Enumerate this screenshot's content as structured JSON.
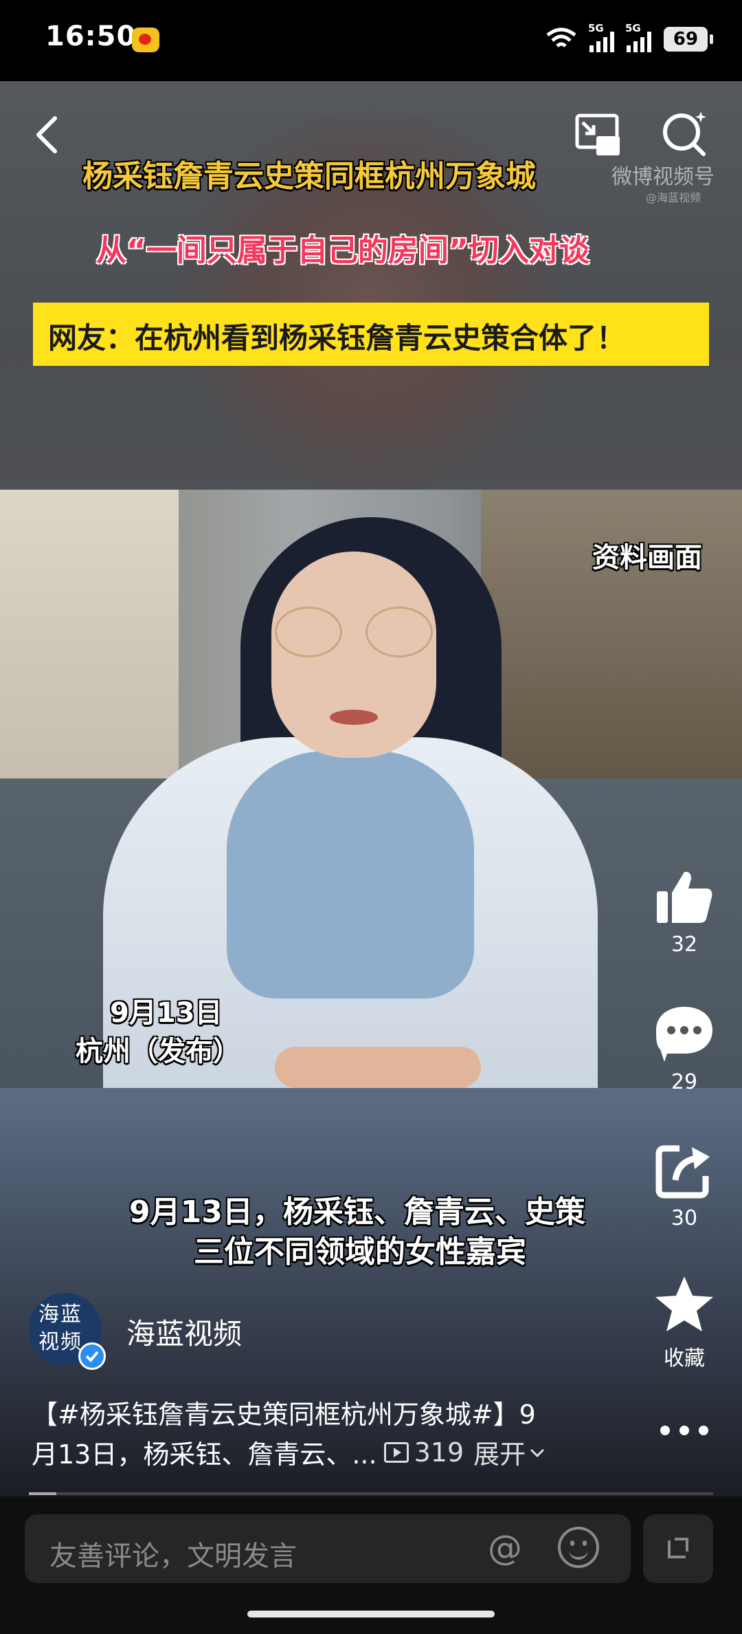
{
  "status_bar": {
    "time": "16:50",
    "signal1": "5G",
    "signal2": "5G",
    "battery": "69"
  },
  "video": {
    "caption_title": "杨采钰詹青云史策同框杭州万象城",
    "watermark": "微博视频号",
    "watermark_sub": "@海蓝视频",
    "caption_subtitle": "从“一间只属于自己的房间”切入对谈",
    "banner": "网友：在杭州看到杨采钰詹青云史策合体了！",
    "archive_label": "资料画面",
    "date_line1": "9月13日",
    "date_line2": "杭州（发布）",
    "bottom_line1": "9月13日，杨采钰、詹青云、史策",
    "bottom_line2": "三位不同领域的女性嘉宾"
  },
  "rail": {
    "like_count": "32",
    "comment_count": "29",
    "share_count": "30",
    "favorite_label": "收藏"
  },
  "author": {
    "avatar_text": "海蓝视频",
    "name": "海蓝视频"
  },
  "description": {
    "line1": "【#杨采钰詹青云史策同框杭州万象城#】9",
    "line2": "月13日，杨采钰、詹青云、...",
    "play_count": "319",
    "expand": "展开"
  },
  "playback_progress": 0.04,
  "comment_bar": {
    "placeholder": "友善评论，文明发言",
    "at": "@"
  }
}
